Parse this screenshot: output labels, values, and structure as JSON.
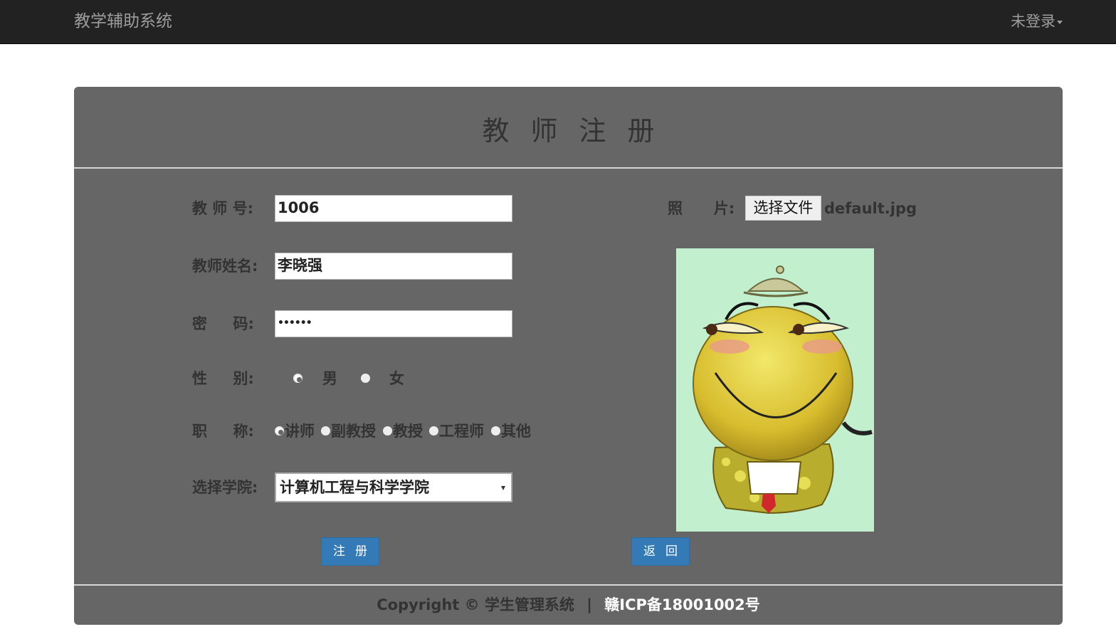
{
  "navbar": {
    "brand": "教学辅助系统",
    "login": "未登录"
  },
  "panel": {
    "title": "教师注册"
  },
  "form": {
    "teacher_id": {
      "label": "教 师 号:",
      "value": "1006"
    },
    "teacher_name": {
      "label": "教师姓名:",
      "value": "李晓强"
    },
    "password": {
      "label": "密     码:",
      "value": "••••••"
    },
    "gender": {
      "label": "性     别:",
      "options": [
        "男",
        "女"
      ],
      "selected": "男"
    },
    "title": {
      "label": "职     称:",
      "options": [
        "讲师",
        "副教授",
        "教授",
        "工程师",
        "其他"
      ],
      "selected": "讲师"
    },
    "college": {
      "label": "选择学院:",
      "value": "计算机工程与科学学院"
    },
    "photo": {
      "label": "照      片:",
      "button": "选择文件",
      "filename": "default.jpg"
    }
  },
  "buttons": {
    "register": "注册",
    "back": "返回"
  },
  "footer": {
    "copyright": "Copyright © 学生管理系统",
    "separator": "|",
    "icp": "赣ICP备18001002号"
  }
}
